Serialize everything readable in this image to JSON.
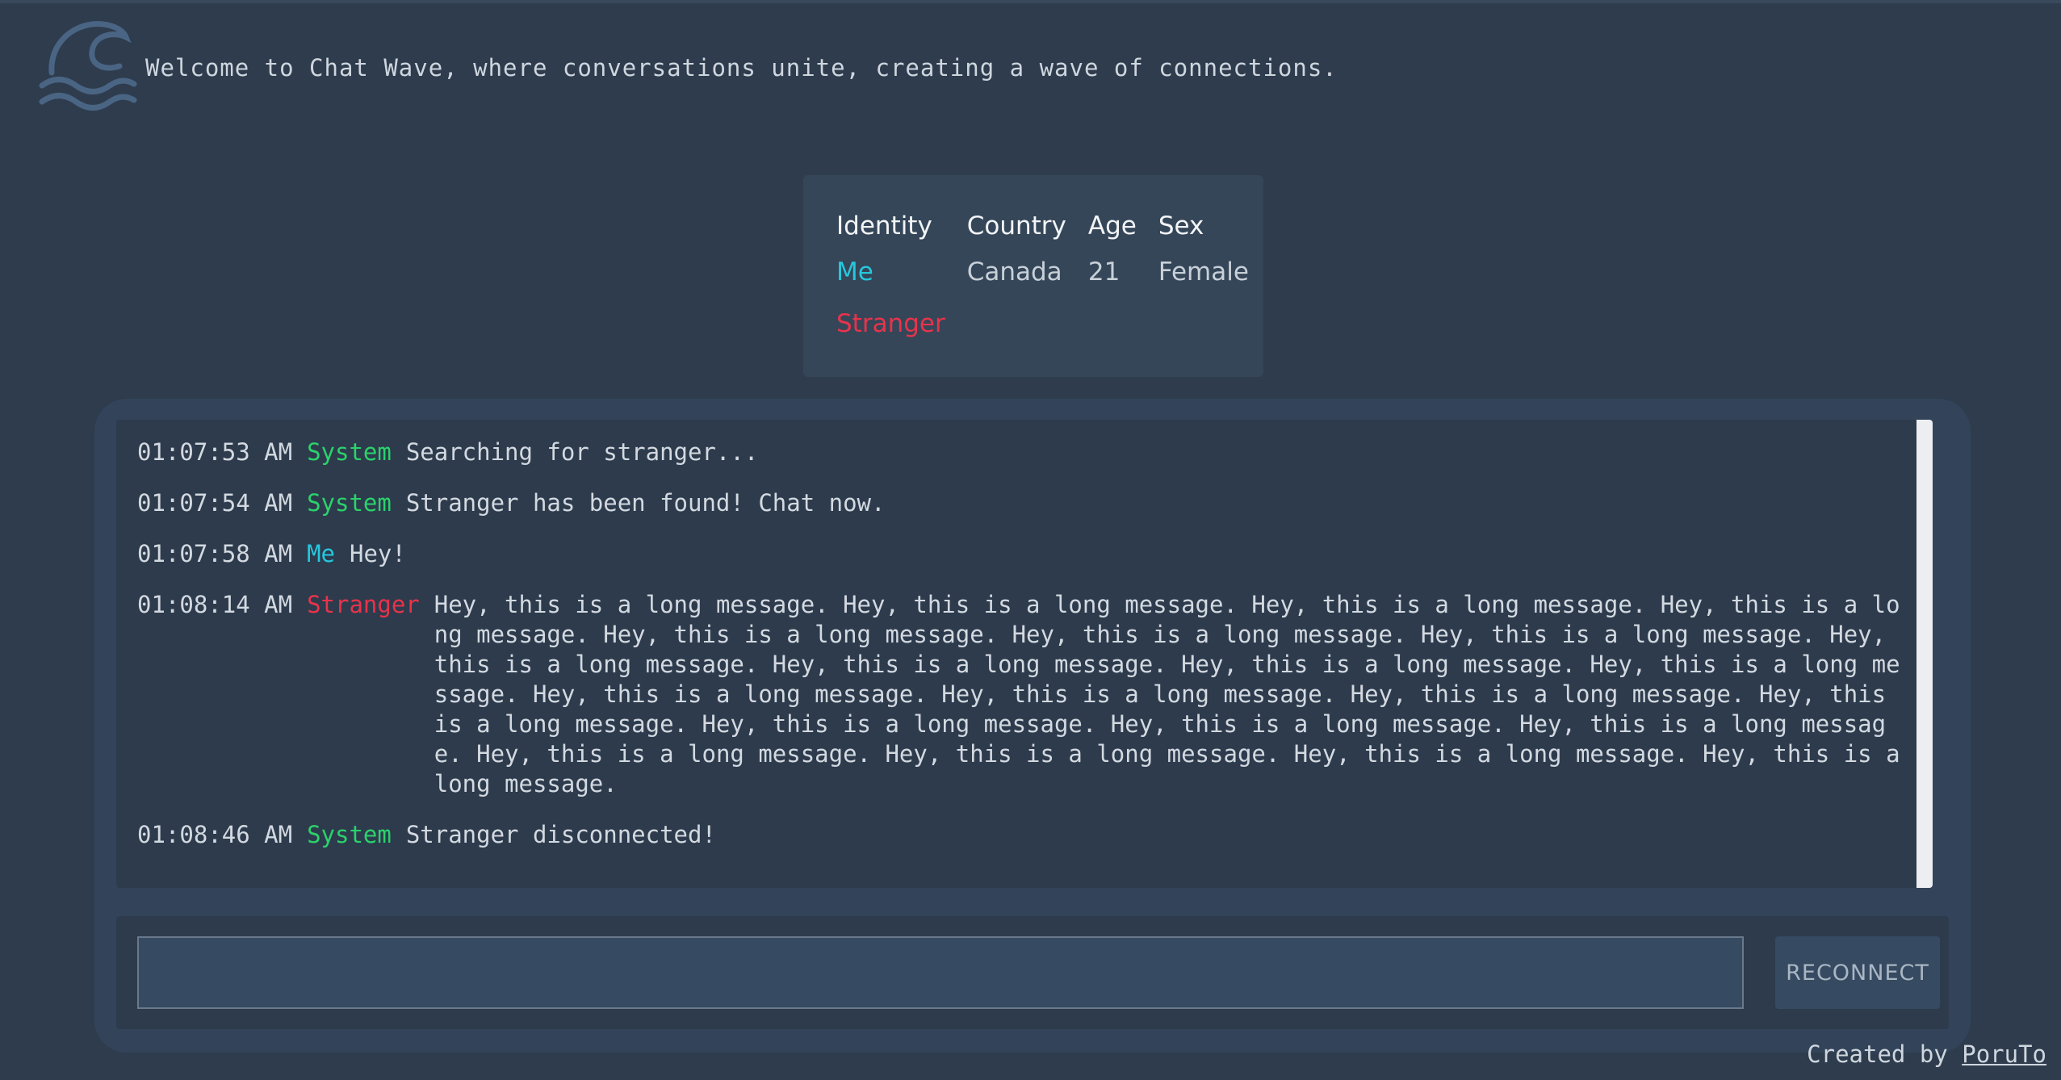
{
  "header": {
    "logo_icon": "wave-icon",
    "welcome_text": "Welcome to Chat Wave, where conversations unite, creating a wave of connections."
  },
  "info_table": {
    "columns": [
      "Identity",
      "Country",
      "Age",
      "Sex"
    ],
    "rows": [
      {
        "identity": "Me",
        "country": "Canada",
        "age": "21",
        "sex": "Female"
      },
      {
        "identity": "Stranger",
        "country": "",
        "age": "",
        "sex": ""
      }
    ]
  },
  "messages": [
    {
      "time": "01:07:53 AM",
      "sender": "System",
      "text": "Searching for stranger..."
    },
    {
      "time": "01:07:54 AM",
      "sender": "System",
      "text": "Stranger has been found! Chat now."
    },
    {
      "time": "01:07:58 AM",
      "sender": "Me",
      "text": "Hey!"
    },
    {
      "time": "01:08:14 AM",
      "sender": "Stranger",
      "text": "Hey, this is a long message. Hey, this is a long message. Hey, this is a long message. Hey, this is a long message. Hey, this is a long message. Hey, this is a long message. Hey, this is a long message. Hey, this is a long message. Hey, this is a long message. Hey, this is a long message. Hey, this is a long message. Hey, this is a long message. Hey, this is a long message. Hey, this is a long message. Hey, this is a long message. Hey, this is a long message. Hey, this is a long message. Hey, this is a long message. Hey, this is a long message. Hey, this is a long message. Hey, this is a long message. Hey, this is a long message."
    },
    {
      "time": "01:08:46 AM",
      "sender": "System",
      "text": "Stranger disconnected!"
    }
  ],
  "composer": {
    "input_value": "",
    "button_label": "RECONNECT"
  },
  "footer": {
    "prefix": "Created by",
    "author": "PoruTo"
  },
  "colors": {
    "background": "#2e3c4e",
    "me": "#25c8dd",
    "stranger": "#e8334a",
    "system": "#2bd26b"
  }
}
